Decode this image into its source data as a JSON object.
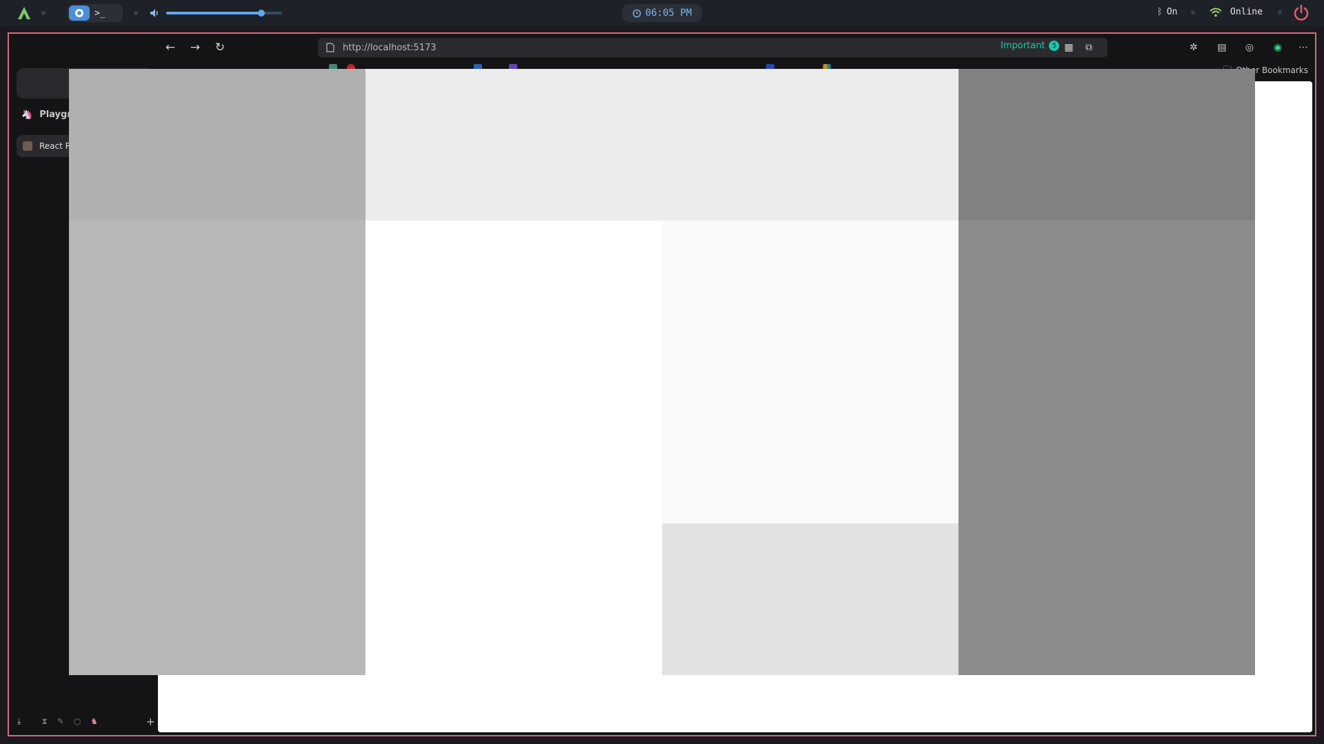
{
  "panel": {
    "clock": "06:05 PM",
    "bluetooth_label": "On",
    "network_label": "Online",
    "volume_percent": 82
  },
  "browser": {
    "url": "http://localhost:5173",
    "important_label": "Important",
    "important_count": "5",
    "other_bookmarks": "Other Bookmarks"
  },
  "sidebar": {
    "space_name": "Playgro",
    "tab_label": "React Re"
  },
  "colors": {
    "accent_teal": "#1fc6a8",
    "window_border": "#d76a7e",
    "clock_text": "#80b4e8",
    "power": "#e05a6a"
  }
}
